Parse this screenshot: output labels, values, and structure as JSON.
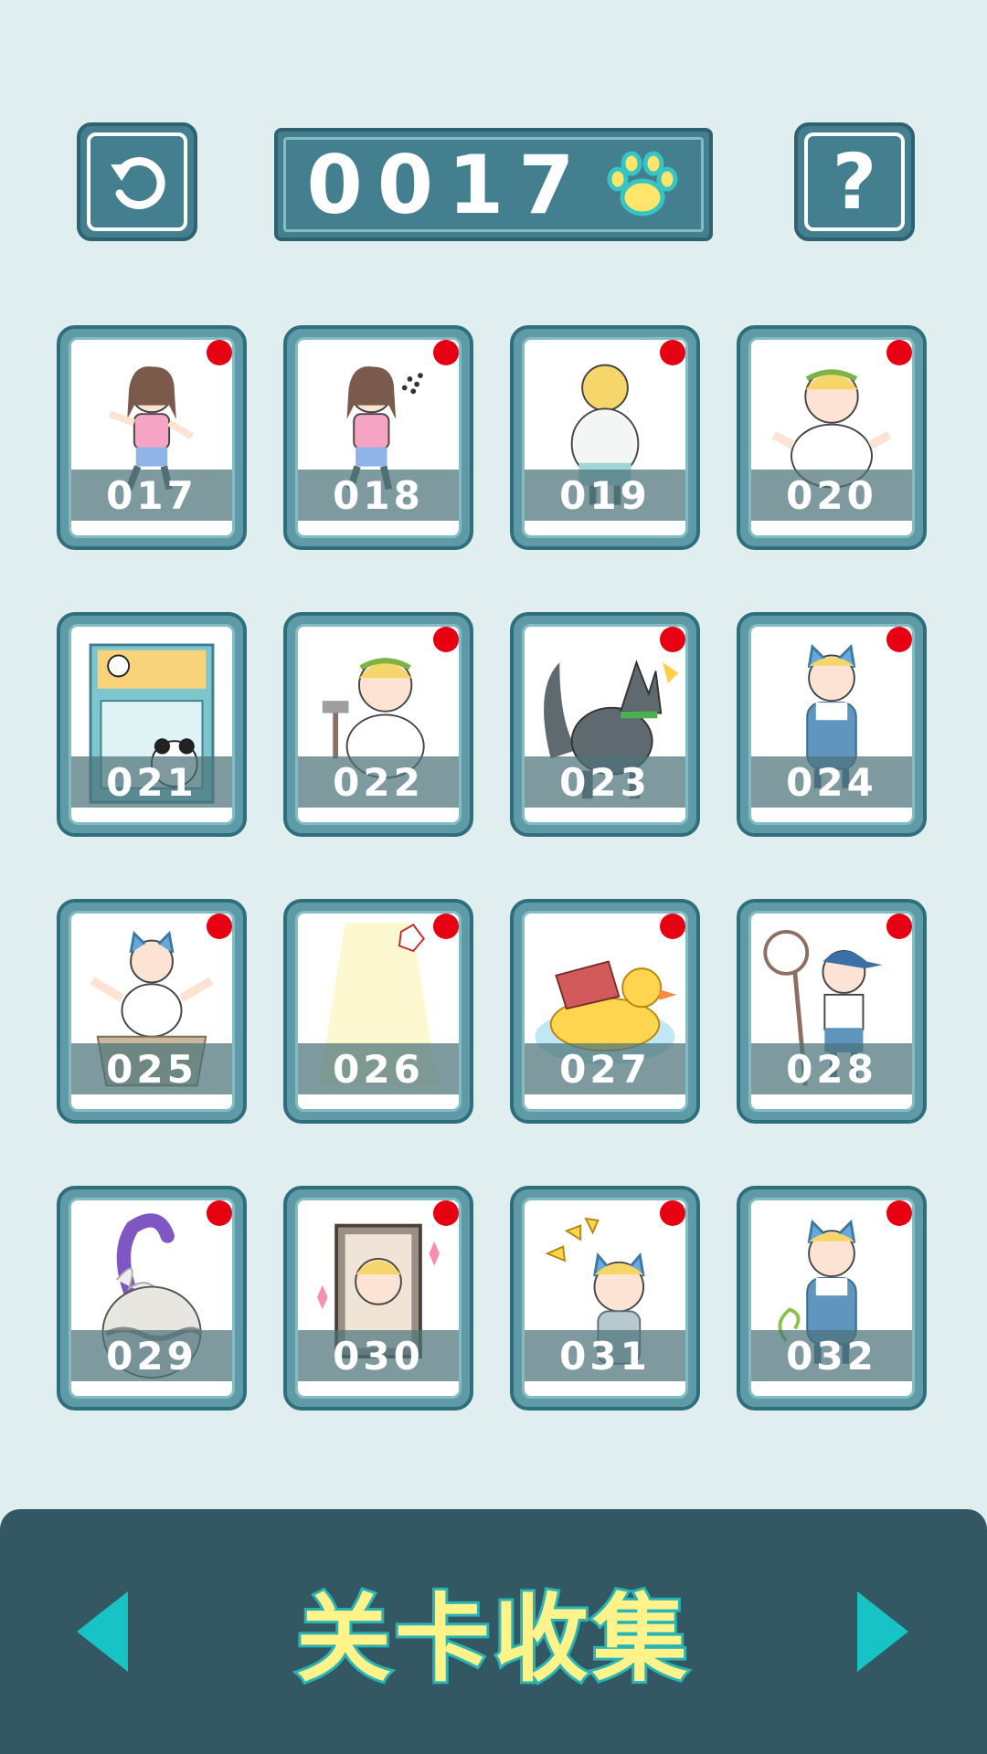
{
  "header": {
    "counter_value": "0017",
    "paw_icon": "paw-icon",
    "back_icon": "undo-icon",
    "help_label": "?"
  },
  "levels": [
    {
      "number": "017",
      "new": true,
      "art": "girl-dancing"
    },
    {
      "number": "018",
      "new": true,
      "art": "girl-swatting-bugs"
    },
    {
      "number": "019",
      "new": true,
      "art": "angry-blonde-man-back"
    },
    {
      "number": "020",
      "new": true,
      "art": "laurel-man-shrugging"
    },
    {
      "number": "021",
      "new": false,
      "art": "claw-machine-panda"
    },
    {
      "number": "022",
      "new": true,
      "art": "laurel-man-hammer"
    },
    {
      "number": "023",
      "new": true,
      "art": "husky-barking"
    },
    {
      "number": "024",
      "new": true,
      "art": "cat-ear-boy-overalls"
    },
    {
      "number": "025",
      "new": true,
      "art": "boy-in-box"
    },
    {
      "number": "026",
      "new": true,
      "art": "spotlight"
    },
    {
      "number": "027",
      "new": true,
      "art": "rubber-duck-float"
    },
    {
      "number": "028",
      "new": true,
      "art": "boy-with-net-crying"
    },
    {
      "number": "029",
      "new": true,
      "art": "snake-in-jar"
    },
    {
      "number": "030",
      "new": true,
      "art": "portrait-frame"
    },
    {
      "number": "031",
      "new": true,
      "art": "cat-ear-boy-happy"
    },
    {
      "number": "032",
      "new": true,
      "art": "cat-ear-boy-overalls-smiling"
    }
  ],
  "footer": {
    "title": "关卡收集",
    "prev_icon": "triangle-left-icon",
    "next_icon": "triangle-right-icon"
  },
  "colors": {
    "background": "#e0eef0",
    "panel": "#437f8e",
    "footer": "#345764",
    "new_dot": "#e60012",
    "title_fill": "#fff38a",
    "title_stroke": "#2ab5b5",
    "arrow": "#18c3c6"
  }
}
